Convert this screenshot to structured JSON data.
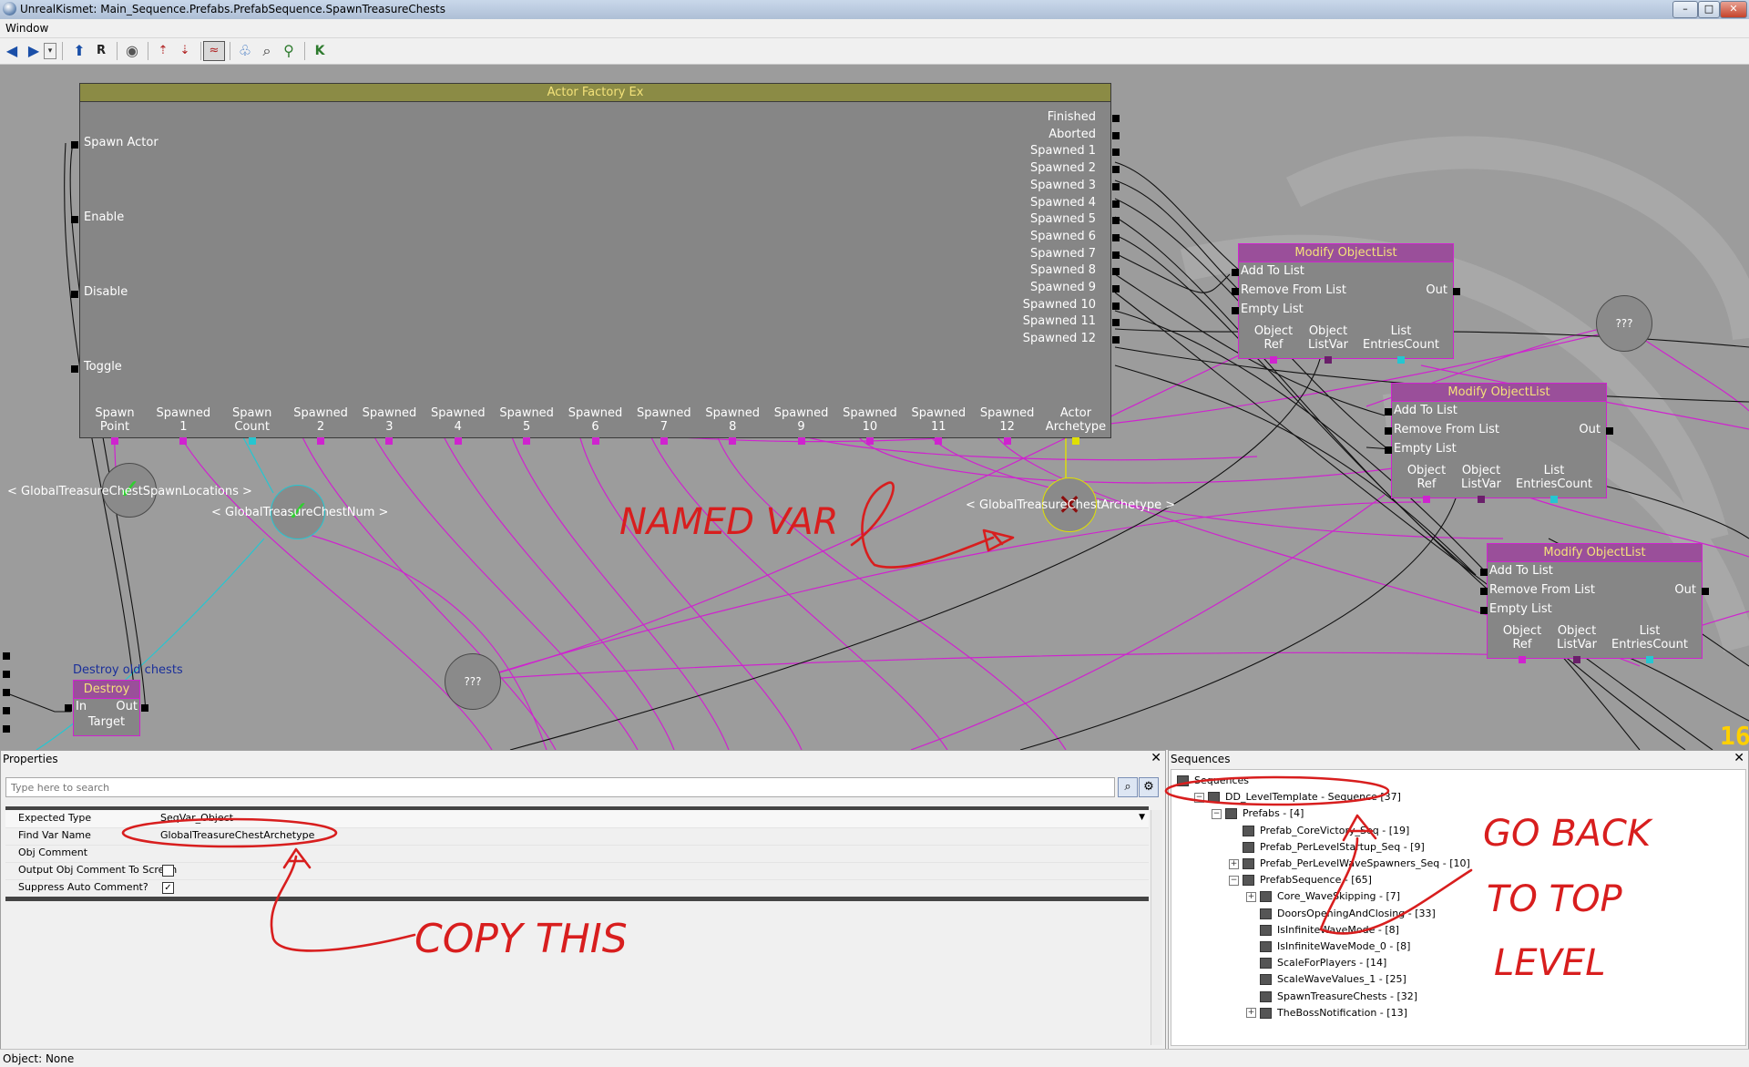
{
  "window": {
    "title": "UnrealKismet: Main_Sequence.Prefabs.PrefabSequence.SpawnTreasureChests",
    "controls": {
      "minimize": "–",
      "maximize": "□",
      "close": "✕"
    }
  },
  "menu": {
    "items": [
      "Window"
    ]
  },
  "canvas": {
    "fps": "16",
    "actor_factory": {
      "title": "Actor Factory Ex",
      "inputs": [
        "Spawn Actor",
        "Enable",
        "Disable",
        "Toggle"
      ],
      "outputs": [
        "Finished",
        "Aborted",
        "Spawned 1",
        "Spawned 2",
        "Spawned 3",
        "Spawned 4",
        "Spawned 5",
        "Spawned 6",
        "Spawned 7",
        "Spawned 8",
        "Spawned 9",
        "Spawned 10",
        "Spawned 11",
        "Spawned 12"
      ],
      "var_links": [
        [
          "Spawn",
          "Point"
        ],
        [
          "Spawned",
          "1"
        ],
        [
          "Spawn",
          "Count"
        ],
        [
          "Spawned",
          "2"
        ],
        [
          "Spawned",
          "3"
        ],
        [
          "Spawned",
          "4"
        ],
        [
          "Spawned",
          "5"
        ],
        [
          "Spawned",
          "6"
        ],
        [
          "Spawned",
          "7"
        ],
        [
          "Spawned",
          "8"
        ],
        [
          "Spawned",
          "9"
        ],
        [
          "Spawned",
          "10"
        ],
        [
          "Spawned",
          "11"
        ],
        [
          "Spawned",
          "12"
        ],
        [
          "Actor",
          "Archetype"
        ]
      ]
    },
    "modify_nodes": [
      {
        "title": "Modify ObjectList",
        "inputs": [
          "Add To List",
          "Remove From List",
          "Empty List"
        ],
        "output": "Out",
        "var_links": [
          [
            "Object",
            "Ref"
          ],
          [
            "Object",
            "ListVar"
          ],
          [
            "List",
            "EntriesCount"
          ]
        ]
      },
      {
        "title": "Modify ObjectList",
        "inputs": [
          "Add To List",
          "Remove From List",
          "Empty List"
        ],
        "output": "Out",
        "var_links": [
          [
            "Object",
            "Ref"
          ],
          [
            "Object",
            "ListVar"
          ],
          [
            "List",
            "EntriesCount"
          ]
        ]
      },
      {
        "title": "Modify ObjectList",
        "inputs": [
          "Add To List",
          "Remove From List",
          "Empty List"
        ],
        "output": "Out",
        "var_links": [
          [
            "Object",
            "Ref"
          ],
          [
            "Object",
            "ListVar"
          ],
          [
            "List",
            "EntriesCount"
          ]
        ]
      }
    ],
    "destroy": {
      "comment": "Destroy old chests",
      "title": "Destroy",
      "input": "In",
      "output": "Out",
      "var_link": "Target"
    },
    "variables": {
      "spawn_locations": "< GlobalTreasureChestSpawnLocations >",
      "chest_num": "< GlobalTreasureChestNum >",
      "archetype": "< GlobalTreasureChestArchetype >",
      "unknown_1": "???",
      "unknown_2": "???"
    }
  },
  "properties": {
    "title": "Properties",
    "close": "✕",
    "search_placeholder": "Type here to search",
    "rows": [
      {
        "name": "Expected Type",
        "value": "SeqVar_Object"
      },
      {
        "name": "Find Var Name",
        "value": "GlobalTreasureChestArchetype"
      },
      {
        "name": "Obj Comment",
        "value": ""
      },
      {
        "name": "Output Obj Comment To Screen",
        "checked": false
      },
      {
        "name": "Suppress Auto Comment?",
        "checked": true
      }
    ]
  },
  "sequences": {
    "title": "Sequences",
    "close": "✕",
    "tree": [
      {
        "label": "Sequences",
        "depth": 0,
        "expander": ""
      },
      {
        "label": "DD_LevelTemplate - Sequence [37]",
        "depth": 1,
        "expander": "−"
      },
      {
        "label": "Prefabs - [4]",
        "depth": 2,
        "expander": "−"
      },
      {
        "label": "Prefab_CoreVictory_Seq - [19]",
        "depth": 3,
        "expander": ""
      },
      {
        "label": "Prefab_PerLevelStartup_Seq - [9]",
        "depth": 3,
        "expander": ""
      },
      {
        "label": "Prefab_PerLevelWaveSpawners_Seq - [10]",
        "depth": 3,
        "expander": "+"
      },
      {
        "label": "PrefabSequence - [65]",
        "depth": 3,
        "expander": "−"
      },
      {
        "label": "Core_WaveSkipping - [7]",
        "depth": 4,
        "expander": "+"
      },
      {
        "label": "DoorsOpeningAndClosing - [33]",
        "depth": 4,
        "expander": ""
      },
      {
        "label": "IsInfiniteWaveMode - [8]",
        "depth": 4,
        "expander": ""
      },
      {
        "label": "IsInfiniteWaveMode_0 - [8]",
        "depth": 4,
        "expander": ""
      },
      {
        "label": "ScaleForPlayers - [14]",
        "depth": 4,
        "expander": ""
      },
      {
        "label": "ScaleWaveValues_1 - [25]",
        "depth": 4,
        "expander": ""
      },
      {
        "label": "SpawnTreasureChests - [32]",
        "depth": 4,
        "expander": ""
      },
      {
        "label": "TheBossNotification - [13]",
        "depth": 4,
        "expander": "+"
      }
    ]
  },
  "status": {
    "text": "Object: None"
  },
  "annotations": {
    "named_var": "NAMED VAR",
    "copy_this": "COPY THIS",
    "go_back_1": "GO BACK",
    "go_back_2": "TO TOP",
    "go_back_3": "LEVEL"
  },
  "colors": {
    "canvas": "#9c9c9c",
    "node_body": "#868686",
    "object_link": "#cf23cf",
    "int_link": "#25c6d1",
    "annotation_red": "#d81e1e",
    "header_text": "#f3e27a"
  }
}
